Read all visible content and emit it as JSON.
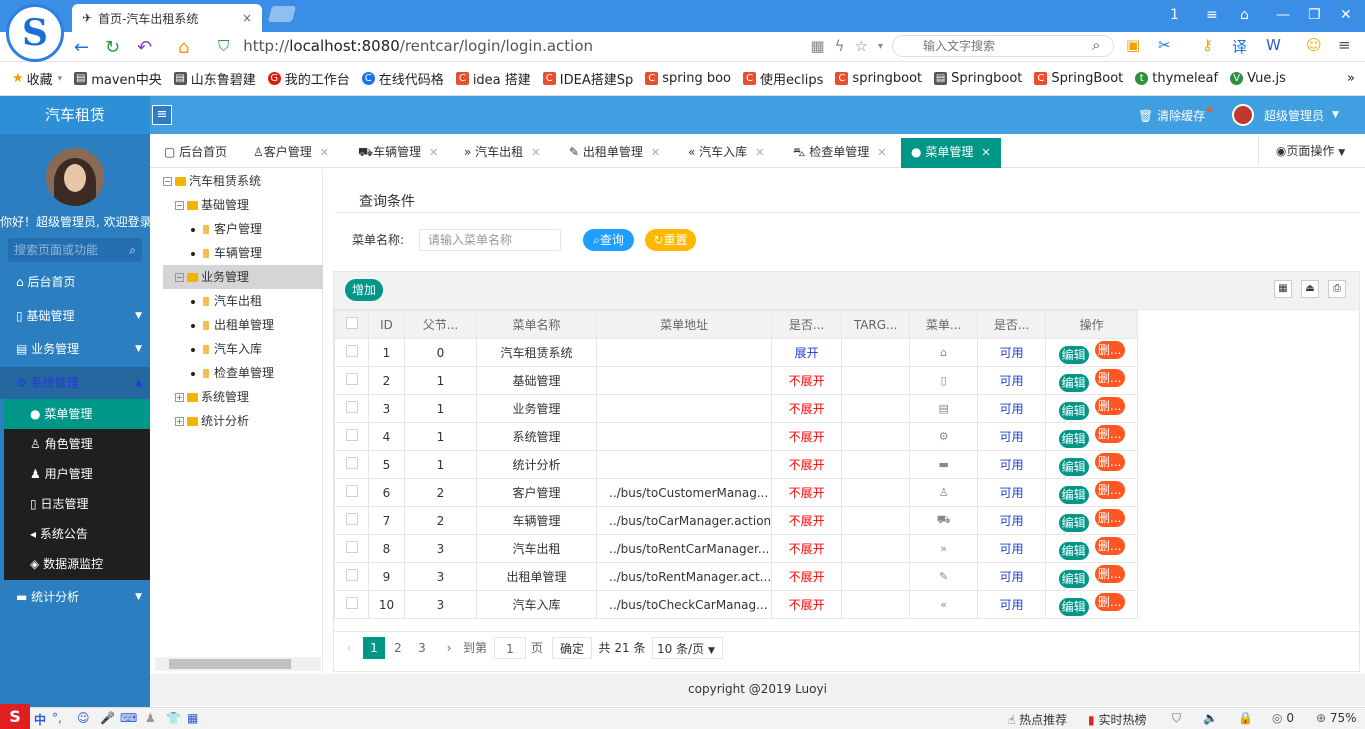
{
  "browser": {
    "tab_title": "首页-汽车出租系统",
    "tab_close": "×",
    "url_prefix": "http://",
    "url_host": "localhost:8080",
    "url_path": "/rentcar/login/login.action",
    "search_placeholder": "输入文字搜索",
    "window_buttons": [
      "1",
      "≡",
      "⌂",
      "—",
      "❐",
      "✕"
    ],
    "bookmarks": [
      {
        "label": "收藏",
        "icon": "star-icon"
      },
      {
        "label": "maven中央",
        "icon": "doc-icon"
      },
      {
        "label": "山东鲁碧建",
        "icon": "doc-icon"
      },
      {
        "label": "我的工作台",
        "icon": "g-icon"
      },
      {
        "label": "在线代码格",
        "icon": "c-icon"
      },
      {
        "label": "idea 搭建",
        "icon": "c-icon"
      },
      {
        "label": "IDEA搭建Sp",
        "icon": "c-icon"
      },
      {
        "label": "spring boo",
        "icon": "c-icon"
      },
      {
        "label": "使用eclips",
        "icon": "c-icon"
      },
      {
        "label": "springboot",
        "icon": "c-icon"
      },
      {
        "label": "Springboot",
        "icon": "doc-icon"
      },
      {
        "label": "SpringBoot",
        "icon": "c-icon"
      },
      {
        "label": "thymeleaf",
        "icon": "t-icon"
      },
      {
        "label": "Vue.js",
        "icon": "vue-icon"
      }
    ],
    "more": "»"
  },
  "header": {
    "brand": "汽车租赁",
    "menu_toggle": "≡",
    "clear_cache": "清除缓存",
    "user": "超级管理员"
  },
  "sidebar": {
    "welcome": "你好！超级管理员, 欢迎登录",
    "search_placeholder": "搜索页面或功能",
    "items": [
      {
        "label": "后台首页",
        "icon": "⌂"
      },
      {
        "label": "基础管理",
        "icon": "▯"
      },
      {
        "label": "业务管理",
        "icon": "▤"
      },
      {
        "label": "系统管理",
        "icon": "⚙"
      },
      {
        "label": "统计分析",
        "icon": "▬"
      }
    ],
    "sub_items": [
      {
        "label": "菜单管理",
        "icon": "●"
      },
      {
        "label": "角色管理",
        "icon": "♙"
      },
      {
        "label": "用户管理",
        "icon": "♟"
      },
      {
        "label": "日志管理",
        "icon": "▯"
      },
      {
        "label": "系统公告",
        "icon": "◂"
      },
      {
        "label": "数据源监控",
        "icon": "◈"
      }
    ]
  },
  "tabs": [
    {
      "label": "后台首页",
      "icon": "▢"
    },
    {
      "label": "客户管理",
      "icon": "♙"
    },
    {
      "label": "车辆管理",
      "icon": "⛟"
    },
    {
      "label": "汽车出租",
      "icon": "»"
    },
    {
      "label": "出租单管理",
      "icon": "✎"
    },
    {
      "label": "汽车入库",
      "icon": "«"
    },
    {
      "label": "检查单管理",
      "icon": "⛍"
    },
    {
      "label": "菜单管理",
      "icon": "●"
    }
  ],
  "page_ops": "页面操作",
  "tree": [
    {
      "label": "汽车租赁系统",
      "type": "root"
    },
    {
      "label": "基础管理",
      "type": "folder-open"
    },
    {
      "label": "客户管理",
      "type": "leaf"
    },
    {
      "label": "车辆管理",
      "type": "leaf"
    },
    {
      "label": "业务管理",
      "type": "folder-open"
    },
    {
      "label": "汽车出租",
      "type": "leaf"
    },
    {
      "label": "出租单管理",
      "type": "leaf"
    },
    {
      "label": "汽车入库",
      "type": "leaf"
    },
    {
      "label": "检查单管理",
      "type": "leaf"
    },
    {
      "label": "系统管理",
      "type": "folder-closed"
    },
    {
      "label": "统计分析",
      "type": "folder-closed"
    }
  ],
  "query": {
    "legend": "查询条件",
    "label": "菜单名称:",
    "placeholder": "请输入菜单名称",
    "search_btn": "查询",
    "reset_btn": "重置"
  },
  "table": {
    "add_btn": "增加",
    "toolbar_icons": [
      "▦",
      "⏏",
      "⎙"
    ],
    "columns": [
      "ID",
      "父节...",
      "菜单名称",
      "菜单地址",
      "是否...",
      "TARG...",
      "菜单...",
      "是否...",
      "操作"
    ],
    "edit_label": "编辑",
    "delete_label": "删...",
    "rows": [
      {
        "id": "1",
        "pid": "0",
        "name": "汽车租赁系统",
        "url": "",
        "spread": "展开",
        "target": "",
        "icon": "⌂",
        "available": "可用"
      },
      {
        "id": "2",
        "pid": "1",
        "name": "基础管理",
        "url": "",
        "spread": "不展开",
        "target": "",
        "icon": "▯",
        "available": "可用"
      },
      {
        "id": "3",
        "pid": "1",
        "name": "业务管理",
        "url": "",
        "spread": "不展开",
        "target": "",
        "icon": "▤",
        "available": "可用"
      },
      {
        "id": "4",
        "pid": "1",
        "name": "系统管理",
        "url": "",
        "spread": "不展开",
        "target": "",
        "icon": "⚙",
        "available": "可用"
      },
      {
        "id": "5",
        "pid": "1",
        "name": "统计分析",
        "url": "",
        "spread": "不展开",
        "target": "",
        "icon": "▬",
        "available": "可用"
      },
      {
        "id": "6",
        "pid": "2",
        "name": "客户管理",
        "url": "../bus/toCustomerManag...",
        "spread": "不展开",
        "target": "",
        "icon": "♙",
        "available": "可用"
      },
      {
        "id": "7",
        "pid": "2",
        "name": "车辆管理",
        "url": "../bus/toCarManager.action",
        "spread": "不展开",
        "target": "",
        "icon": "⛟",
        "available": "可用"
      },
      {
        "id": "8",
        "pid": "3",
        "name": "汽车出租",
        "url": "../bus/toRentCarManager...",
        "spread": "不展开",
        "target": "",
        "icon": "»",
        "available": "可用"
      },
      {
        "id": "9",
        "pid": "3",
        "name": "出租单管理",
        "url": "../bus/toRentManager.act...",
        "spread": "不展开",
        "target": "",
        "icon": "✎",
        "available": "可用"
      },
      {
        "id": "10",
        "pid": "3",
        "name": "汽车入库",
        "url": "../bus/toCheckCarManag...",
        "spread": "不展开",
        "target": "",
        "icon": "«",
        "available": "可用"
      }
    ]
  },
  "pager": {
    "prev": "‹",
    "pages": [
      "1",
      "2",
      "3"
    ],
    "next": "›",
    "goto_label": "到第",
    "goto_value": "1",
    "page_unit": "页",
    "confirm": "确定",
    "total": "共 21 条",
    "page_size": "10 条/页"
  },
  "footer": "copyright @2019 Luoyi",
  "statusbar": {
    "ime": "中",
    "hot": "热点推荐",
    "realtime": "实时热榜",
    "zero": "0",
    "zoom": "75%"
  },
  "colors": {
    "header_blue": "#3f9fe0",
    "sidebar_blue": "#2b7fc0",
    "teal": "#009688",
    "orange": "#ff5722",
    "query_blue": "#1e9fff",
    "reset_yellow": "#ffb800"
  }
}
